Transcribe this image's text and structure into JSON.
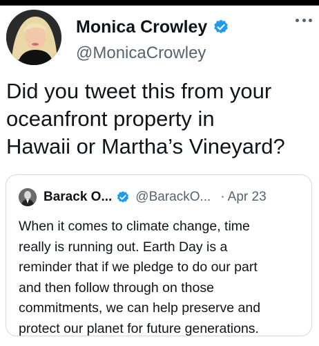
{
  "tweet": {
    "author": {
      "name": "Monica Crowley",
      "handle": "@MonicaCrowley",
      "verified": true,
      "avatar_icon": "profile-photo"
    },
    "text": "Did you tweet this from your\noceanfront property in\nHawaii or Martha’s Vineyard?",
    "menu_icon": "more-options-icon"
  },
  "quoted_tweet": {
    "author": {
      "name": "Barack O...",
      "handle": "@BarackO...",
      "verified": true,
      "avatar_icon": "profile-photo"
    },
    "separator": "·",
    "date": "Apr 23",
    "text": "When it comes to climate change, time\nreally is running out. Earth Day is a\nreminder that if we pledge to do our part\nand then follow through on those\ncommitments, we can help preserve and\nprotect our planet for future generations."
  },
  "colors": {
    "verified_blue": "#1d9bf0",
    "text_primary": "#0f1419",
    "text_secondary": "#536471",
    "border": "#cfd9de",
    "top_bar": "#000000"
  }
}
